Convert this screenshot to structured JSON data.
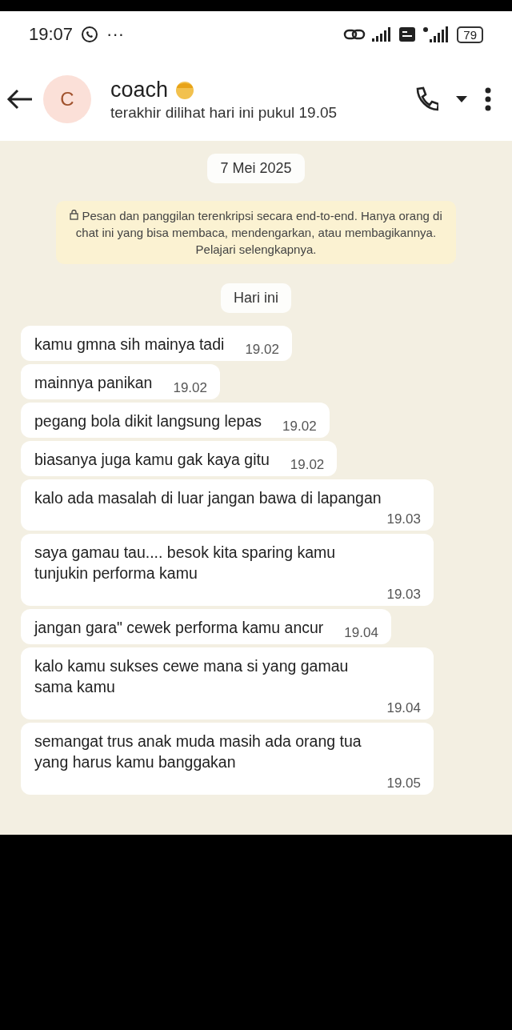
{
  "status_bar": {
    "time": "19:07",
    "dots": "···",
    "battery": "79"
  },
  "header": {
    "avatar_letter": "C",
    "name": "coach",
    "last_seen": "terakhir dilihat hari ini pukul 19.05"
  },
  "date_chip": "7 Mei 2025",
  "encryption_notice": "Pesan dan panggilan terenkripsi secara end-to-end. Hanya orang di chat ini yang bisa membaca, mendengarkan, atau membagikannya. Pelajari selengkapnya.",
  "day_chip": "Hari ini",
  "messages": [
    {
      "text": "kamu gmna sih mainya tadi",
      "time": "19.02"
    },
    {
      "text": "mainnya panikan",
      "time": "19.02"
    },
    {
      "text": "pegang bola dikit langsung lepas",
      "time": "19.02"
    },
    {
      "text": "biasanya juga kamu gak kaya gitu",
      "time": "19.02"
    },
    {
      "text": "kalo ada masalah di luar jangan bawa di lapangan",
      "time": "19.03"
    },
    {
      "text": "saya gamau tau.... besok kita sparing kamu tunjukin performa kamu",
      "time": "19.03"
    },
    {
      "text": "jangan gara\" cewek performa kamu ancur",
      "time": "19.04"
    },
    {
      "text": "kalo kamu sukses cewe mana si yang gamau sama kamu",
      "time": "19.04"
    },
    {
      "text": "semangat trus anak muda masih ada orang tua yang harus kamu banggakan",
      "time": "19.05"
    }
  ]
}
